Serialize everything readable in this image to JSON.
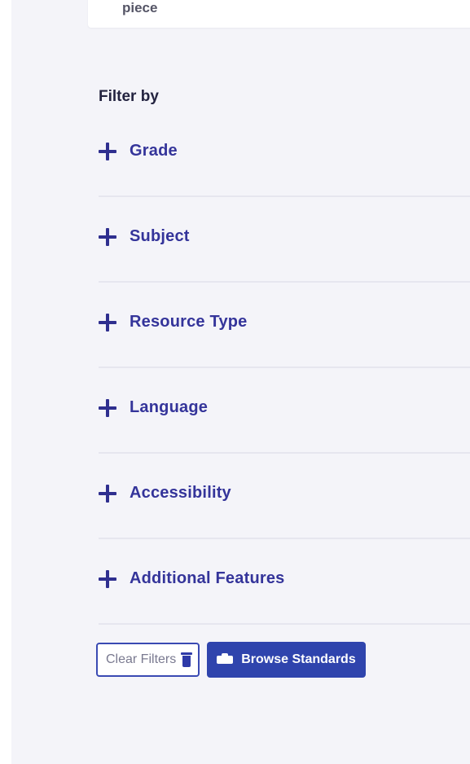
{
  "search": {
    "value": "piece"
  },
  "filters": {
    "heading": "Filter by",
    "items": [
      {
        "label": "Grade",
        "icon": "plus-icon"
      },
      {
        "label": "Subject",
        "icon": "plus-icon"
      },
      {
        "label": "Resource Type",
        "icon": "plus-icon"
      },
      {
        "label": "Language",
        "icon": "plus-icon"
      },
      {
        "label": "Accessibility",
        "icon": "plus-icon"
      },
      {
        "label": "Additional Features",
        "icon": "plus-icon"
      }
    ]
  },
  "actions": {
    "clear_label": "Clear Filters",
    "clear_icon": "trash-icon",
    "browse_label": "Browse Standards",
    "browse_icon": "graduation-cap-icon"
  },
  "colors": {
    "accent": "#2f44ad",
    "filter_text": "#34349a",
    "panel_bg": "#f4f4f9"
  }
}
